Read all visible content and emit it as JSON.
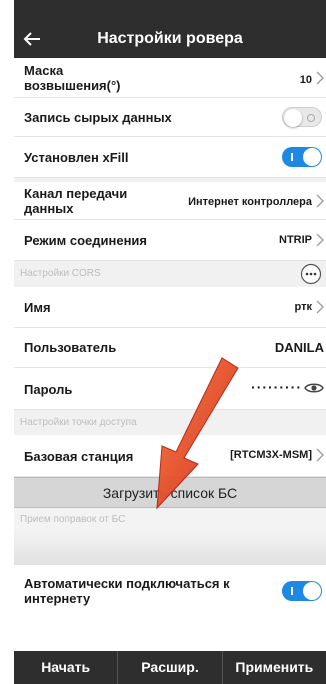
{
  "header": {
    "title": "Настройки ровера"
  },
  "rows": {
    "elevation_mask": {
      "label_line1": "Маска",
      "label_line2": "возвышения(°)",
      "value": "10"
    },
    "raw_data": {
      "label": "Запись сырых данных",
      "toggle": "off"
    },
    "xfill": {
      "label": "Установлен xFill",
      "toggle": "on"
    },
    "channel": {
      "label_line1": "Канал передачи",
      "label_line2": "данных",
      "value": "Интернет контроллера"
    },
    "conn_mode": {
      "label": "Режим соединения",
      "value": "NTRIP"
    },
    "name": {
      "label": "Имя",
      "value": "ртк"
    },
    "user": {
      "label": "Пользователь",
      "value": "DANILA"
    },
    "password": {
      "label": "Пароль",
      "value": "·········"
    },
    "base_station": {
      "label": "Базовая станция",
      "value": "[RTCM3X-MSM]"
    },
    "auto_connect": {
      "label_line1": "Автоматически подключаться к",
      "label_line2": "интернету",
      "toggle": "on"
    }
  },
  "sections": {
    "cors": "Настройки CORS",
    "access_point": "Настройки точки доступа",
    "corrections": "Прием поправок от БС"
  },
  "load_button": "Загрузить список БС",
  "bottom": {
    "start": "Начать",
    "advanced": "Расшир.",
    "apply": "Применить"
  },
  "colors": {
    "accent": "#1e88e5",
    "bar": "#2e2e2e",
    "arrow": "#e53e1a"
  },
  "icons": [
    "back-arrow-icon",
    "chevron-right-icon",
    "more-icon",
    "eye-icon",
    "annotation-arrow"
  ]
}
